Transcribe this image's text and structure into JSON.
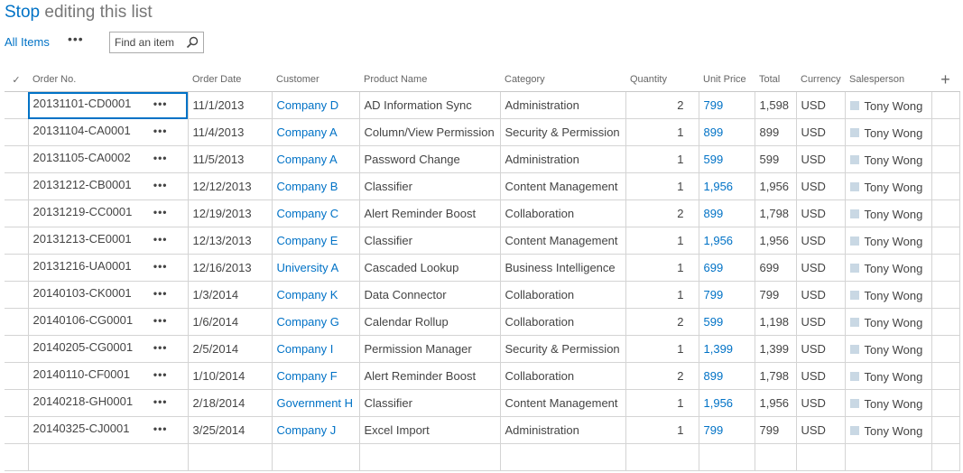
{
  "title": {
    "stop": "Stop",
    "rest": " editing this list"
  },
  "viewbar": {
    "all_items": "All Items",
    "more": "•••",
    "search_placeholder": "Find an item"
  },
  "columns": {
    "check": "✓",
    "order_no": "Order No.",
    "order_date": "Order Date",
    "customer": "Customer",
    "product": "Product Name",
    "category": "Category",
    "quantity": "Quantity",
    "unit_price": "Unit Price",
    "total": "Total",
    "currency": "Currency",
    "salesperson": "Salesperson",
    "add": "+"
  },
  "rows": [
    {
      "order_no": "20131101-CD0001",
      "order_date": "11/1/2013",
      "customer": "Company D",
      "product": "AD Information Sync",
      "category": "Administration",
      "quantity": "2",
      "unit_price": "799",
      "total": "1,598",
      "currency": "USD",
      "salesperson": "Tony Wong"
    },
    {
      "order_no": "20131104-CA0001",
      "order_date": "11/4/2013",
      "customer": "Company A",
      "product": "Column/View Permission",
      "category": "Security & Permission",
      "quantity": "1",
      "unit_price": "899",
      "total": "899",
      "currency": "USD",
      "salesperson": "Tony Wong"
    },
    {
      "order_no": "20131105-CA0002",
      "order_date": "11/5/2013",
      "customer": "Company A",
      "product": "Password Change",
      "category": "Administration",
      "quantity": "1",
      "unit_price": "599",
      "total": "599",
      "currency": "USD",
      "salesperson": "Tony Wong"
    },
    {
      "order_no": "20131212-CB0001",
      "order_date": "12/12/2013",
      "customer": "Company B",
      "product": "Classifier",
      "category": "Content Management",
      "quantity": "1",
      "unit_price": "1,956",
      "total": "1,956",
      "currency": "USD",
      "salesperson": "Tony Wong"
    },
    {
      "order_no": "20131219-CC0001",
      "order_date": "12/19/2013",
      "customer": "Company C",
      "product": "Alert Reminder Boost",
      "category": "Collaboration",
      "quantity": "2",
      "unit_price": "899",
      "total": "1,798",
      "currency": "USD",
      "salesperson": "Tony Wong"
    },
    {
      "order_no": "20131213-CE0001",
      "order_date": "12/13/2013",
      "customer": "Company E",
      "product": "Classifier",
      "category": "Content Management",
      "quantity": "1",
      "unit_price": "1,956",
      "total": "1,956",
      "currency": "USD",
      "salesperson": "Tony Wong"
    },
    {
      "order_no": "20131216-UA0001",
      "order_date": "12/16/2013",
      "customer": "University A",
      "product": "Cascaded Lookup",
      "category": "Business Intelligence",
      "quantity": "1",
      "unit_price": "699",
      "total": "699",
      "currency": "USD",
      "salesperson": "Tony Wong"
    },
    {
      "order_no": "20140103-CK0001",
      "order_date": "1/3/2014",
      "customer": "Company K",
      "product": "Data Connector",
      "category": "Collaboration",
      "quantity": "1",
      "unit_price": "799",
      "total": "799",
      "currency": "USD",
      "salesperson": "Tony Wong"
    },
    {
      "order_no": "20140106-CG0001",
      "order_date": "1/6/2014",
      "customer": "Company G",
      "product": "Calendar Rollup",
      "category": "Collaboration",
      "quantity": "2",
      "unit_price": "599",
      "total": "1,198",
      "currency": "USD",
      "salesperson": "Tony Wong"
    },
    {
      "order_no": "20140205-CG0001",
      "order_date": "2/5/2014",
      "customer": "Company I",
      "product": "Permission Manager",
      "category": "Security & Permission",
      "quantity": "1",
      "unit_price": "1,399",
      "total": "1,399",
      "currency": "USD",
      "salesperson": "Tony Wong"
    },
    {
      "order_no": "20140110-CF0001",
      "order_date": "1/10/2014",
      "customer": "Company F",
      "product": "Alert Reminder Boost",
      "category": "Collaboration",
      "quantity": "2",
      "unit_price": "899",
      "total": "1,798",
      "currency": "USD",
      "salesperson": "Tony Wong"
    },
    {
      "order_no": "20140218-GH0001",
      "order_date": "2/18/2014",
      "customer": "Government H",
      "product": "Classifier",
      "category": "Content Management",
      "quantity": "1",
      "unit_price": "1,956",
      "total": "1,956",
      "currency": "USD",
      "salesperson": "Tony Wong"
    },
    {
      "order_no": "20140325-CJ0001",
      "order_date": "3/25/2014",
      "customer": "Company J",
      "product": "Excel Import",
      "category": "Administration",
      "quantity": "1",
      "unit_price": "799",
      "total": "799",
      "currency": "USD",
      "salesperson": "Tony Wong"
    }
  ],
  "row_menu": "•••",
  "colors": {
    "link": "#0072c6",
    "person_square": "#c9d8e4",
    "grid_border": "#d4d4d4"
  }
}
